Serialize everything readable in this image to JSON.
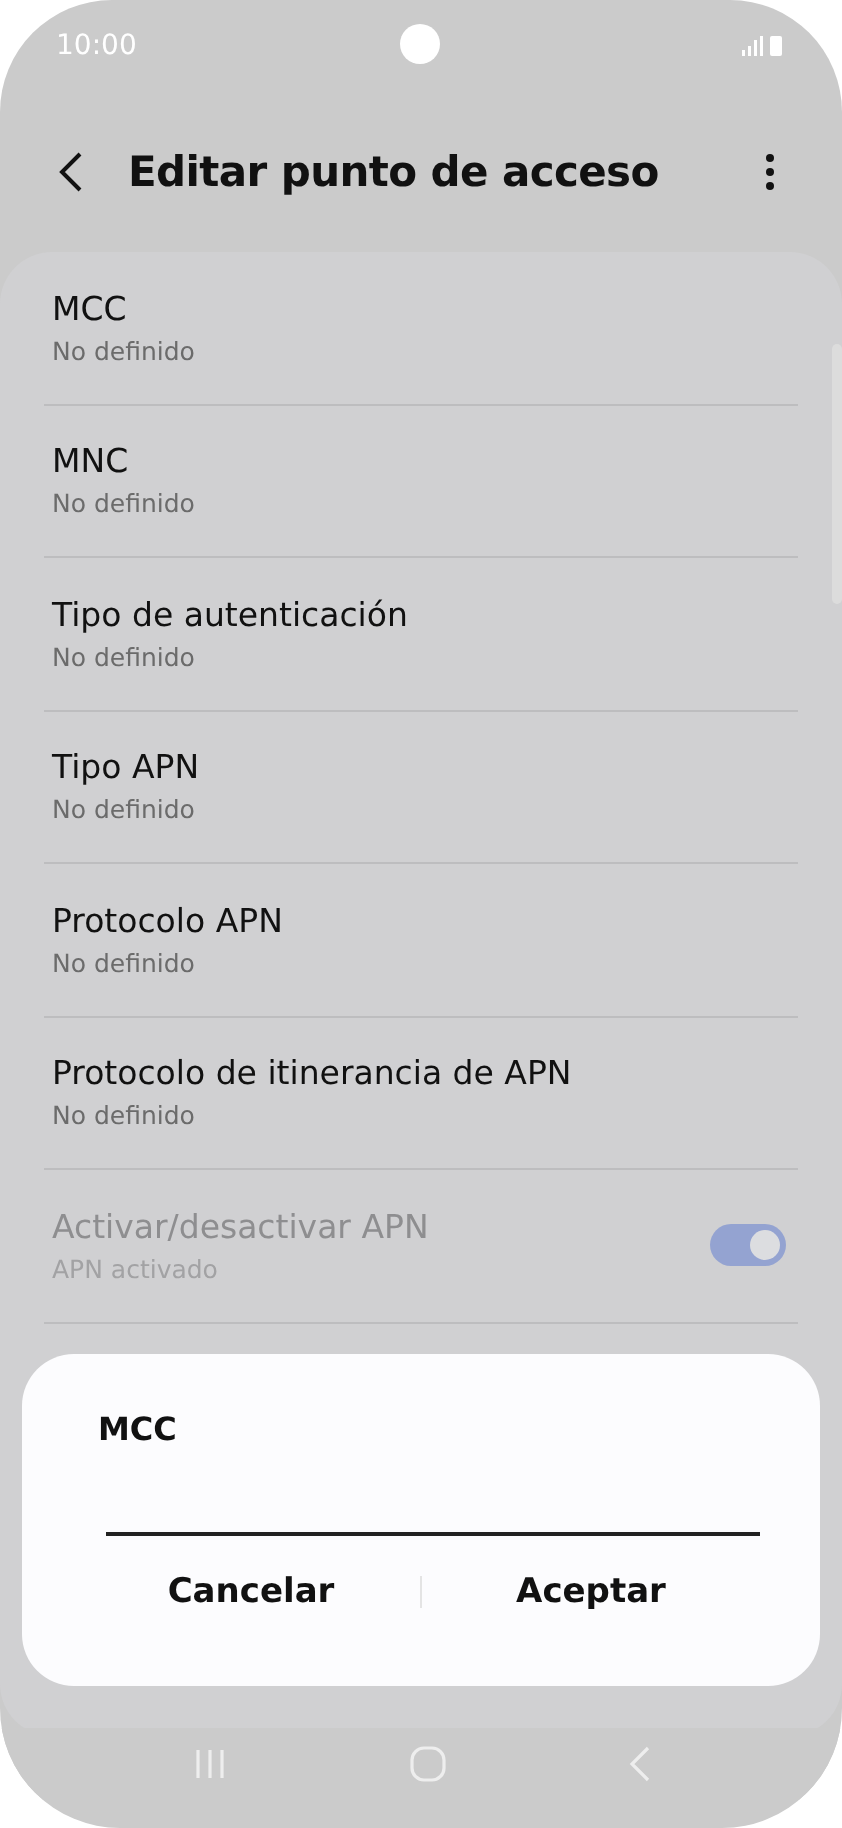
{
  "status_bar": {
    "time": "10:00"
  },
  "header": {
    "title": "Editar punto de acceso"
  },
  "items": [
    {
      "kind": "text",
      "title": "MCC",
      "subtitle": "No definido",
      "disabled": false
    },
    {
      "kind": "text",
      "title": "MNC",
      "subtitle": "No definido",
      "disabled": false
    },
    {
      "kind": "text",
      "title": "Tipo de autenticación",
      "subtitle": "No definido",
      "disabled": false
    },
    {
      "kind": "text",
      "title": "Tipo APN",
      "subtitle": "No definido",
      "disabled": false
    },
    {
      "kind": "text",
      "title": "Protocolo APN",
      "subtitle": "No definido",
      "disabled": false
    },
    {
      "kind": "text",
      "title": "Protocolo de itinerancia de APN",
      "subtitle": "No definido",
      "disabled": false
    },
    {
      "kind": "switch",
      "title": "Activar/desactivar APN",
      "subtitle": "APN activado",
      "disabled": true,
      "on": true
    }
  ],
  "dialog": {
    "title": "MCC",
    "buttons": [
      "Cancelar",
      "Aceptar"
    ]
  }
}
